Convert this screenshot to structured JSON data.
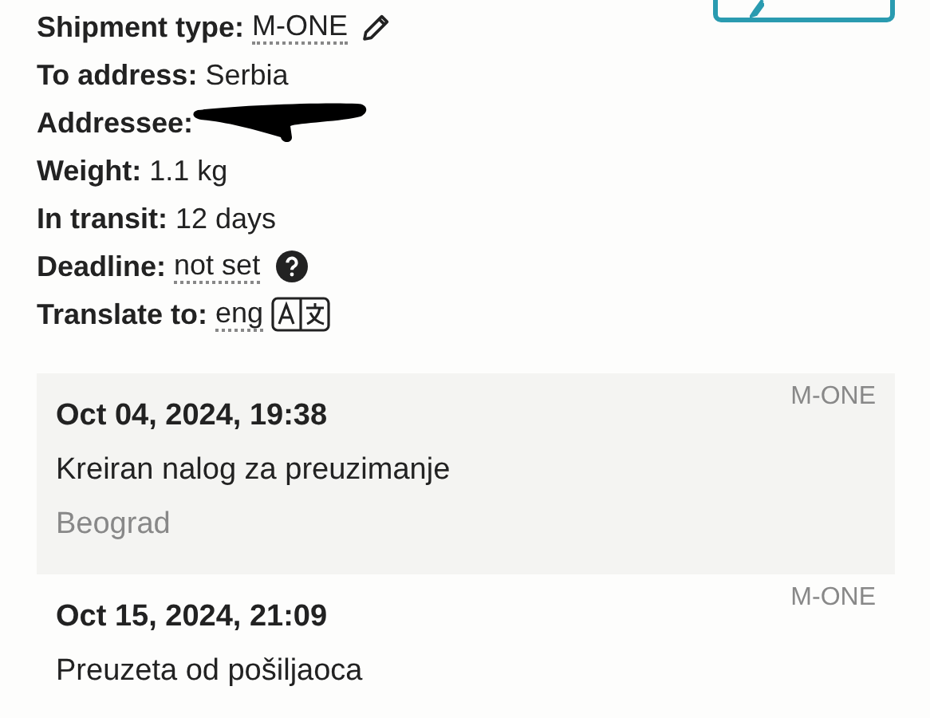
{
  "details": [
    {
      "label": "Shipment type:",
      "value": "M-ONE",
      "kind": "editable"
    },
    {
      "label": "To address:",
      "value": "Serbia",
      "kind": "plain"
    },
    {
      "label": "Addressee:",
      "kind": "redacted"
    },
    {
      "label": "Weight:",
      "value": "1.1 kg",
      "kind": "plain"
    },
    {
      "label": "In transit:",
      "value": "12 days",
      "kind": "plain"
    },
    {
      "label": "Deadline:",
      "value": "not set",
      "kind": "help"
    },
    {
      "label": "Translate to:",
      "value": "eng",
      "kind": "translate"
    }
  ],
  "events": [
    {
      "date": "Oct 04, 2024, 19:38",
      "status": "Kreiran nalog za preuzimanje",
      "location": "Beograd",
      "service": "M-ONE"
    },
    {
      "date": "Oct 15, 2024, 21:09",
      "status": "Preuzeta od pošiljaoca",
      "service": "M-ONE"
    }
  ]
}
